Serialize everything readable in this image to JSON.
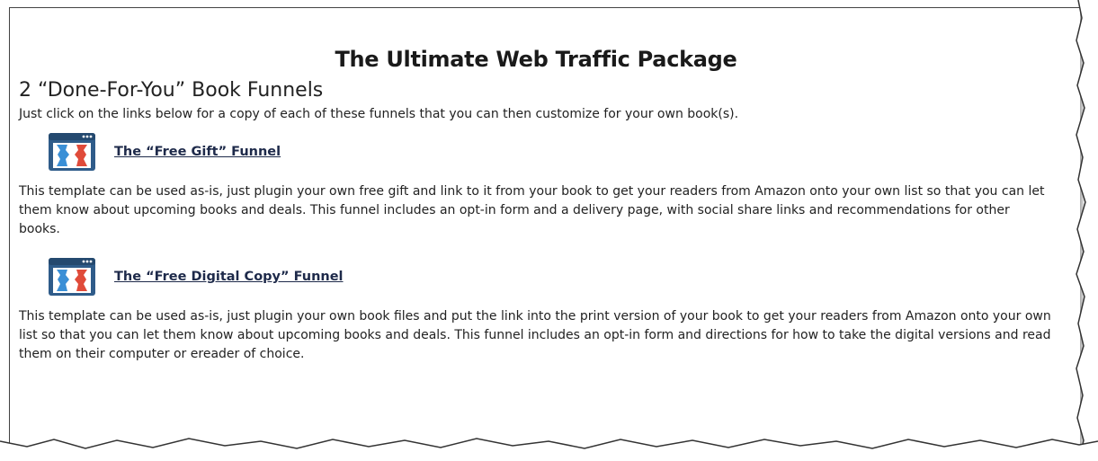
{
  "document": {
    "title": "The Ultimate Web Traffic Package",
    "subtitle": "2 “Done-For-You” Book Funnels",
    "intro": "Just click on the links below for a copy of each of these funnels that you can then customize for your own book(s).",
    "funnels": [
      {
        "icon": "clickfunnels-logo-icon",
        "link_label": "The “Free Gift” Funnel",
        "description": "This template can be used as-is, just plugin your own free gift and link to it from your book to get your readers from Amazon onto your own list so that you can let them know about upcoming books and deals. This funnel includes an opt-in form and a delivery page, with social share links and recommendations for other books."
      },
      {
        "icon": "clickfunnels-logo-icon",
        "link_label": "The “Free Digital Copy” Funnel",
        "description": "This template can be used as-is, just plugin your own book files and put the link into the print version of your book to get your readers from Amazon onto your own list so that you can let them know about upcoming books and deals. This funnel includes an opt-in form and directions for how to take the digital versions and read them on their computer or ereader of choice."
      }
    ]
  },
  "colors": {
    "link": "#1e2a4a",
    "icon_frame": "#2f5c8a",
    "icon_red": "#e04b3a",
    "icon_blue": "#3a8fd6"
  }
}
